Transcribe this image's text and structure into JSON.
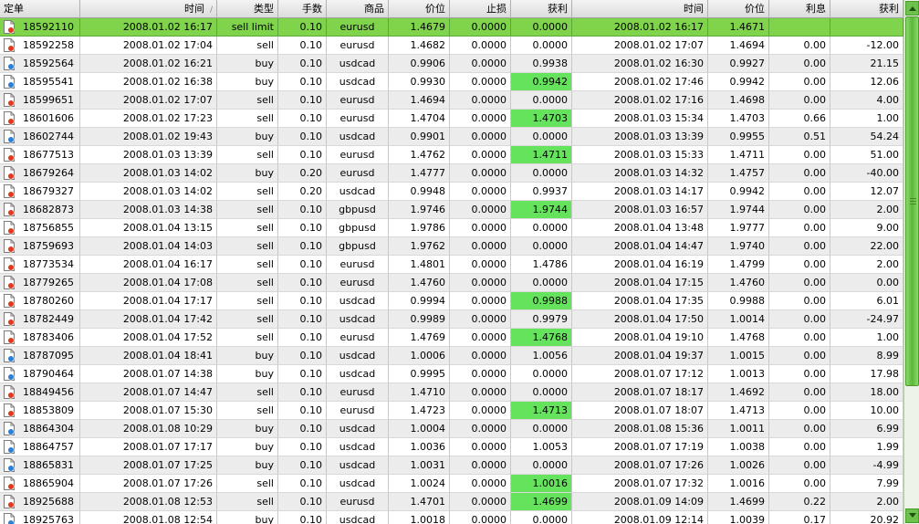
{
  "columns": [
    "定单",
    "时间",
    "类型",
    "手数",
    "商品",
    "价位",
    "止损",
    "获利",
    "时间",
    "价位",
    "利息",
    "获利"
  ],
  "sort_indicator": "/",
  "colors": {
    "pending_row": "#7fd44c",
    "tp_hit": "#66e35c",
    "sell_icon": "#e03a1e",
    "buy_icon": "#2a7fd6"
  },
  "rows": [
    {
      "ticket": "18592110",
      "open_time": "2008.01.02 16:17",
      "type": "sell limit",
      "lots": "0.10",
      "symbol": "eurusd",
      "open_price": "1.4679",
      "sl": "0.0000",
      "tp": "0.0000",
      "close_time": "2008.01.02 16:17",
      "close_price": "1.4671",
      "swap": "",
      "profit": "",
      "icon": "sell-icon",
      "pending": true,
      "tp_hit": false
    },
    {
      "ticket": "18592258",
      "open_time": "2008.01.02 17:04",
      "type": "sell",
      "lots": "0.10",
      "symbol": "eurusd",
      "open_price": "1.4682",
      "sl": "0.0000",
      "tp": "0.0000",
      "close_time": "2008.01.02 17:07",
      "close_price": "1.4694",
      "swap": "0.00",
      "profit": "-12.00",
      "icon": "sell-icon",
      "pending": false,
      "tp_hit": false
    },
    {
      "ticket": "18592564",
      "open_time": "2008.01.02 16:21",
      "type": "buy",
      "lots": "0.10",
      "symbol": "usdcad",
      "open_price": "0.9906",
      "sl": "0.0000",
      "tp": "0.9938",
      "close_time": "2008.01.02 16:30",
      "close_price": "0.9927",
      "swap": "0.00",
      "profit": "21.15",
      "icon": "buy-icon",
      "pending": false,
      "tp_hit": false
    },
    {
      "ticket": "18595541",
      "open_time": "2008.01.02 16:38",
      "type": "buy",
      "lots": "0.10",
      "symbol": "usdcad",
      "open_price": "0.9930",
      "sl": "0.0000",
      "tp": "0.9942",
      "close_time": "2008.01.02 17:46",
      "close_price": "0.9942",
      "swap": "0.00",
      "profit": "12.06",
      "icon": "buy-icon",
      "pending": false,
      "tp_hit": true
    },
    {
      "ticket": "18599651",
      "open_time": "2008.01.02 17:07",
      "type": "sell",
      "lots": "0.10",
      "symbol": "eurusd",
      "open_price": "1.4694",
      "sl": "0.0000",
      "tp": "0.0000",
      "close_time": "2008.01.02 17:16",
      "close_price": "1.4698",
      "swap": "0.00",
      "profit": "4.00",
      "icon": "sell-icon",
      "pending": false,
      "tp_hit": false
    },
    {
      "ticket": "18601606",
      "open_time": "2008.01.02 17:23",
      "type": "sell",
      "lots": "0.10",
      "symbol": "eurusd",
      "open_price": "1.4704",
      "sl": "0.0000",
      "tp": "1.4703",
      "close_time": "2008.01.03 15:34",
      "close_price": "1.4703",
      "swap": "0.66",
      "profit": "1.00",
      "icon": "sell-icon",
      "pending": false,
      "tp_hit": true
    },
    {
      "ticket": "18602744",
      "open_time": "2008.01.02 19:43",
      "type": "buy",
      "lots": "0.10",
      "symbol": "usdcad",
      "open_price": "0.9901",
      "sl": "0.0000",
      "tp": "0.0000",
      "close_time": "2008.01.03 13:39",
      "close_price": "0.9955",
      "swap": "0.51",
      "profit": "54.24",
      "icon": "buy-icon",
      "pending": false,
      "tp_hit": false
    },
    {
      "ticket": "18677513",
      "open_time": "2008.01.03 13:39",
      "type": "sell",
      "lots": "0.10",
      "symbol": "eurusd",
      "open_price": "1.4762",
      "sl": "0.0000",
      "tp": "1.4711",
      "close_time": "2008.01.03 15:33",
      "close_price": "1.4711",
      "swap": "0.00",
      "profit": "51.00",
      "icon": "sell-icon",
      "pending": false,
      "tp_hit": true
    },
    {
      "ticket": "18679264",
      "open_time": "2008.01.03 14:02",
      "type": "buy",
      "lots": "0.20",
      "symbol": "eurusd",
      "open_price": "1.4777",
      "sl": "0.0000",
      "tp": "0.0000",
      "close_time": "2008.01.03 14:32",
      "close_price": "1.4757",
      "swap": "0.00",
      "profit": "-40.00",
      "icon": "sell-icon",
      "pending": false,
      "tp_hit": false
    },
    {
      "ticket": "18679327",
      "open_time": "2008.01.03 14:02",
      "type": "sell",
      "lots": "0.20",
      "symbol": "usdcad",
      "open_price": "0.9948",
      "sl": "0.0000",
      "tp": "0.9937",
      "close_time": "2008.01.03 14:17",
      "close_price": "0.9942",
      "swap": "0.00",
      "profit": "12.07",
      "icon": "sell-icon",
      "pending": false,
      "tp_hit": false
    },
    {
      "ticket": "18682873",
      "open_time": "2008.01.03 14:38",
      "type": "sell",
      "lots": "0.10",
      "symbol": "gbpusd",
      "open_price": "1.9746",
      "sl": "0.0000",
      "tp": "1.9744",
      "close_time": "2008.01.03 16:57",
      "close_price": "1.9744",
      "swap": "0.00",
      "profit": "2.00",
      "icon": "sell-icon",
      "pending": false,
      "tp_hit": true
    },
    {
      "ticket": "18756855",
      "open_time": "2008.01.04 13:15",
      "type": "sell",
      "lots": "0.10",
      "symbol": "gbpusd",
      "open_price": "1.9786",
      "sl": "0.0000",
      "tp": "0.0000",
      "close_time": "2008.01.04 13:48",
      "close_price": "1.9777",
      "swap": "0.00",
      "profit": "9.00",
      "icon": "sell-icon",
      "pending": false,
      "tp_hit": false
    },
    {
      "ticket": "18759693",
      "open_time": "2008.01.04 14:03",
      "type": "sell",
      "lots": "0.10",
      "symbol": "gbpusd",
      "open_price": "1.9762",
      "sl": "0.0000",
      "tp": "0.0000",
      "close_time": "2008.01.04 14:47",
      "close_price": "1.9740",
      "swap": "0.00",
      "profit": "22.00",
      "icon": "sell-icon",
      "pending": false,
      "tp_hit": false
    },
    {
      "ticket": "18773534",
      "open_time": "2008.01.04 16:17",
      "type": "sell",
      "lots": "0.10",
      "symbol": "eurusd",
      "open_price": "1.4801",
      "sl": "0.0000",
      "tp": "1.4786",
      "close_time": "2008.01.04 16:19",
      "close_price": "1.4799",
      "swap": "0.00",
      "profit": "2.00",
      "icon": "sell-icon",
      "pending": false,
      "tp_hit": false
    },
    {
      "ticket": "18779265",
      "open_time": "2008.01.04 17:08",
      "type": "sell",
      "lots": "0.10",
      "symbol": "eurusd",
      "open_price": "1.4760",
      "sl": "0.0000",
      "tp": "0.0000",
      "close_time": "2008.01.04 17:15",
      "close_price": "1.4760",
      "swap": "0.00",
      "profit": "0.00",
      "icon": "sell-icon",
      "pending": false,
      "tp_hit": false
    },
    {
      "ticket": "18780260",
      "open_time": "2008.01.04 17:17",
      "type": "sell",
      "lots": "0.10",
      "symbol": "usdcad",
      "open_price": "0.9994",
      "sl": "0.0000",
      "tp": "0.9988",
      "close_time": "2008.01.04 17:35",
      "close_price": "0.9988",
      "swap": "0.00",
      "profit": "6.01",
      "icon": "sell-icon",
      "pending": false,
      "tp_hit": true
    },
    {
      "ticket": "18782449",
      "open_time": "2008.01.04 17:42",
      "type": "sell",
      "lots": "0.10",
      "symbol": "usdcad",
      "open_price": "0.9989",
      "sl": "0.0000",
      "tp": "0.9979",
      "close_time": "2008.01.04 17:50",
      "close_price": "1.0014",
      "swap": "0.00",
      "profit": "-24.97",
      "icon": "sell-icon",
      "pending": false,
      "tp_hit": false
    },
    {
      "ticket": "18783406",
      "open_time": "2008.01.04 17:52",
      "type": "sell",
      "lots": "0.10",
      "symbol": "eurusd",
      "open_price": "1.4769",
      "sl": "0.0000",
      "tp": "1.4768",
      "close_time": "2008.01.04 19:10",
      "close_price": "1.4768",
      "swap": "0.00",
      "profit": "1.00",
      "icon": "sell-icon",
      "pending": false,
      "tp_hit": true
    },
    {
      "ticket": "18787095",
      "open_time": "2008.01.04 18:41",
      "type": "buy",
      "lots": "0.10",
      "symbol": "usdcad",
      "open_price": "1.0006",
      "sl": "0.0000",
      "tp": "1.0056",
      "close_time": "2008.01.04 19:37",
      "close_price": "1.0015",
      "swap": "0.00",
      "profit": "8.99",
      "icon": "buy-icon",
      "pending": false,
      "tp_hit": false
    },
    {
      "ticket": "18790464",
      "open_time": "2008.01.07 14:38",
      "type": "buy",
      "lots": "0.10",
      "symbol": "usdcad",
      "open_price": "0.9995",
      "sl": "0.0000",
      "tp": "0.0000",
      "close_time": "2008.01.07 17:12",
      "close_price": "1.0013",
      "swap": "0.00",
      "profit": "17.98",
      "icon": "buy-icon",
      "pending": false,
      "tp_hit": false
    },
    {
      "ticket": "18849456",
      "open_time": "2008.01.07 14:47",
      "type": "sell",
      "lots": "0.10",
      "symbol": "eurusd",
      "open_price": "1.4710",
      "sl": "0.0000",
      "tp": "0.0000",
      "close_time": "2008.01.07 18:17",
      "close_price": "1.4692",
      "swap": "0.00",
      "profit": "18.00",
      "icon": "sell-icon",
      "pending": false,
      "tp_hit": false
    },
    {
      "ticket": "18853809",
      "open_time": "2008.01.07 15:30",
      "type": "sell",
      "lots": "0.10",
      "symbol": "eurusd",
      "open_price": "1.4723",
      "sl": "0.0000",
      "tp": "1.4713",
      "close_time": "2008.01.07 18:07",
      "close_price": "1.4713",
      "swap": "0.00",
      "profit": "10.00",
      "icon": "sell-icon",
      "pending": false,
      "tp_hit": true
    },
    {
      "ticket": "18864304",
      "open_time": "2008.01.08 10:29",
      "type": "buy",
      "lots": "0.10",
      "symbol": "usdcad",
      "open_price": "1.0004",
      "sl": "0.0000",
      "tp": "0.0000",
      "close_time": "2008.01.08 15:36",
      "close_price": "1.0011",
      "swap": "0.00",
      "profit": "6.99",
      "icon": "buy-icon",
      "pending": false,
      "tp_hit": false
    },
    {
      "ticket": "18864757",
      "open_time": "2008.01.07 17:17",
      "type": "buy",
      "lots": "0.10",
      "symbol": "usdcad",
      "open_price": "1.0036",
      "sl": "0.0000",
      "tp": "1.0053",
      "close_time": "2008.01.07 17:19",
      "close_price": "1.0038",
      "swap": "0.00",
      "profit": "1.99",
      "icon": "buy-icon",
      "pending": false,
      "tp_hit": false
    },
    {
      "ticket": "18865831",
      "open_time": "2008.01.07 17:25",
      "type": "buy",
      "lots": "0.10",
      "symbol": "usdcad",
      "open_price": "1.0031",
      "sl": "0.0000",
      "tp": "0.0000",
      "close_time": "2008.01.07 17:26",
      "close_price": "1.0026",
      "swap": "0.00",
      "profit": "-4.99",
      "icon": "buy-icon",
      "pending": false,
      "tp_hit": false
    },
    {
      "ticket": "18865904",
      "open_time": "2008.01.07 17:26",
      "type": "sell",
      "lots": "0.10",
      "symbol": "usdcad",
      "open_price": "1.0024",
      "sl": "0.0000",
      "tp": "1.0016",
      "close_time": "2008.01.07 17:32",
      "close_price": "1.0016",
      "swap": "0.00",
      "profit": "7.99",
      "icon": "sell-icon",
      "pending": false,
      "tp_hit": true
    },
    {
      "ticket": "18925688",
      "open_time": "2008.01.08 12:53",
      "type": "sell",
      "lots": "0.10",
      "symbol": "eurusd",
      "open_price": "1.4701",
      "sl": "0.0000",
      "tp": "1.4699",
      "close_time": "2008.01.09 14:09",
      "close_price": "1.4699",
      "swap": "0.22",
      "profit": "2.00",
      "icon": "sell-icon",
      "pending": false,
      "tp_hit": true
    },
    {
      "ticket": "18925763",
      "open_time": "2008.01.08 12:54",
      "type": "buy",
      "lots": "0.10",
      "symbol": "usdcad",
      "open_price": "1.0018",
      "sl": "0.0000",
      "tp": "0.0000",
      "close_time": "2008.01.09 12:14",
      "close_price": "1.0039",
      "swap": "0.17",
      "profit": "20.92",
      "icon": "buy-icon",
      "pending": false,
      "tp_hit": false
    }
  ]
}
